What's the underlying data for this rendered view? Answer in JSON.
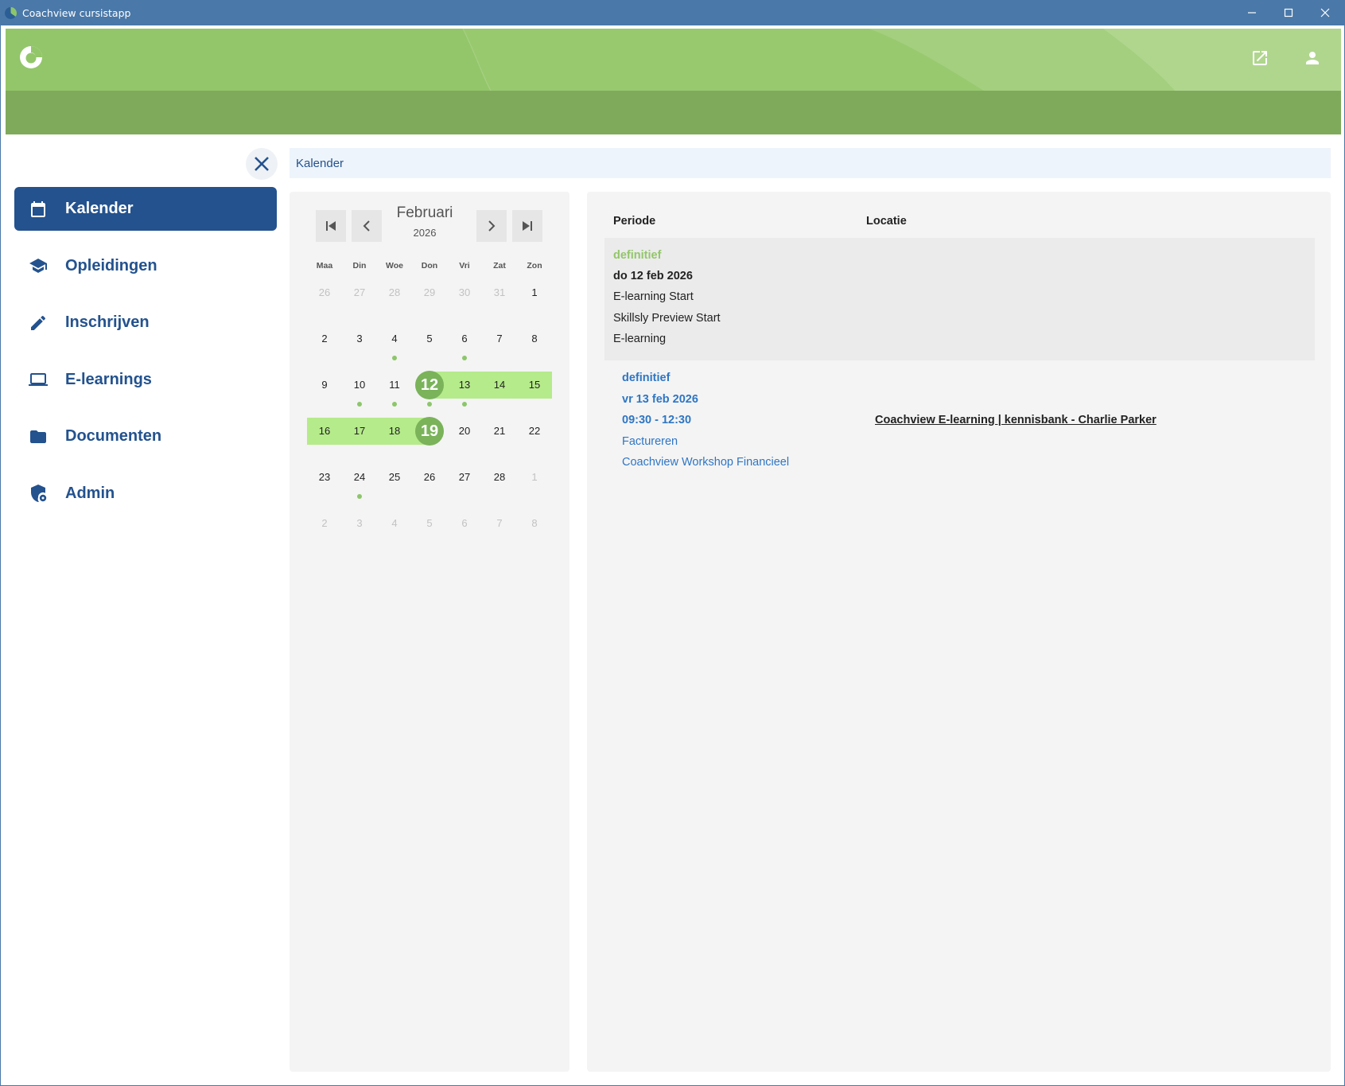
{
  "window": {
    "title": "Coachview cursistapp"
  },
  "header": {
    "logo_icon": "coachview-logo-icon",
    "external_link_icon": "external-link-icon",
    "user_icon": "user-icon",
    "colors": {
      "banner": "#93c66a",
      "subbar": "#7faa5c",
      "accent": "#23528e"
    }
  },
  "sidebar": {
    "items": [
      {
        "label": "Kalender",
        "icon": "calendar-icon",
        "active": true
      },
      {
        "label": "Opleidingen",
        "icon": "graduation-cap-icon",
        "active": false
      },
      {
        "label": "Inschrijven",
        "icon": "pencil-icon",
        "active": false
      },
      {
        "label": "E-learnings",
        "icon": "laptop-icon",
        "active": false
      },
      {
        "label": "Documenten",
        "icon": "folder-icon",
        "active": false
      },
      {
        "label": "Admin",
        "icon": "shield-gear-icon",
        "active": false
      }
    ]
  },
  "breadcrumb": {
    "current": "Kalender"
  },
  "calendar": {
    "month": "Februari",
    "year": "2026",
    "weekdays": [
      "Maa",
      "Din",
      "Woe",
      "Don",
      "Vri",
      "Zat",
      "Zon"
    ],
    "weeks": [
      [
        {
          "d": "26",
          "muted": true
        },
        {
          "d": "27",
          "muted": true
        },
        {
          "d": "28",
          "muted": true
        },
        {
          "d": "29",
          "muted": true
        },
        {
          "d": "30",
          "muted": true
        },
        {
          "d": "31",
          "muted": true
        },
        {
          "d": "1"
        }
      ],
      [
        {
          "d": "2"
        },
        {
          "d": "3"
        },
        {
          "d": "4",
          "dot": true
        },
        {
          "d": "5"
        },
        {
          "d": "6",
          "dot": true
        },
        {
          "d": "7"
        },
        {
          "d": "8"
        }
      ],
      [
        {
          "d": "9"
        },
        {
          "d": "10",
          "dot": true
        },
        {
          "d": "11",
          "dot": true
        },
        {
          "d": "12",
          "dot": true,
          "selected": true,
          "range": "start"
        },
        {
          "d": "13",
          "dot": true,
          "range": "mid"
        },
        {
          "d": "14",
          "range": "mid"
        },
        {
          "d": "15",
          "range": "mid"
        }
      ],
      [
        {
          "d": "16",
          "range": "mid"
        },
        {
          "d": "17",
          "range": "mid"
        },
        {
          "d": "18",
          "range": "mid"
        },
        {
          "d": "19",
          "selected": true,
          "range": "end"
        },
        {
          "d": "20"
        },
        {
          "d": "21"
        },
        {
          "d": "22"
        }
      ],
      [
        {
          "d": "23"
        },
        {
          "d": "24",
          "dot": true
        },
        {
          "d": "25"
        },
        {
          "d": "26"
        },
        {
          "d": "27"
        },
        {
          "d": "28"
        },
        {
          "d": "1",
          "muted": true
        }
      ],
      [
        {
          "d": "2",
          "muted": true
        },
        {
          "d": "3",
          "muted": true
        },
        {
          "d": "4",
          "muted": true
        },
        {
          "d": "5",
          "muted": true
        },
        {
          "d": "6",
          "muted": true
        },
        {
          "d": "7",
          "muted": true
        },
        {
          "d": "8",
          "muted": true
        }
      ]
    ]
  },
  "details": {
    "col_periode": "Periode",
    "col_locatie": "Locatie",
    "events": [
      {
        "status": "definitief",
        "date": "do 12 feb 2026",
        "line1": "E-learning Start",
        "line2": "Skillsly Preview Start",
        "line3": "E-learning",
        "location": ""
      },
      {
        "status": "definitief",
        "date": "vr 13 feb 2026",
        "time": "09:30 - 12:30",
        "line1": "Factureren",
        "line2": "Coachview Workshop Financieel",
        "location": "Coachview E-learning | kennisbank - Charlie Parker"
      }
    ]
  }
}
